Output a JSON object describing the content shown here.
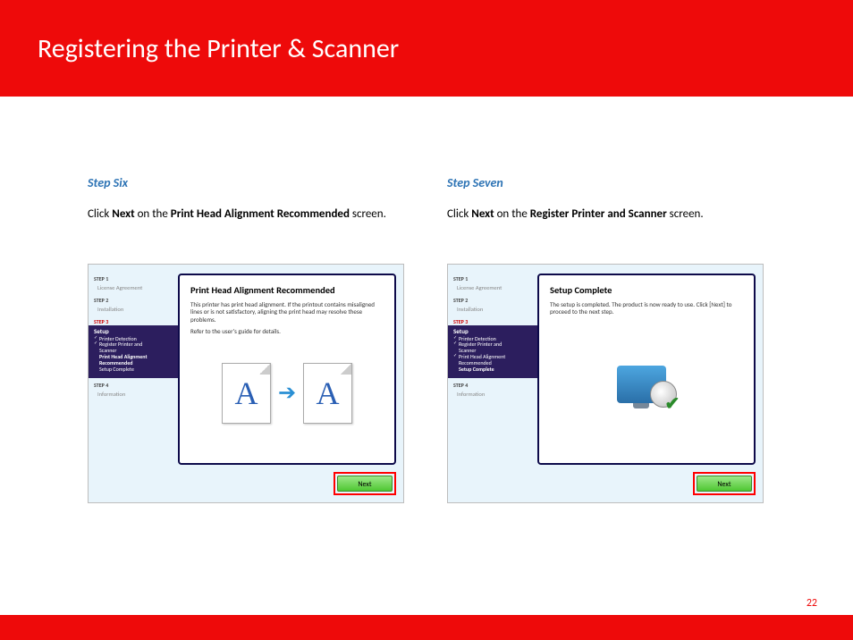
{
  "header": {
    "title": "Registering the Printer & Scanner"
  },
  "page_number": "22",
  "step6": {
    "label": "Step Six",
    "text_pre": "Click ",
    "text_bold1": "Next",
    "text_mid": " on the ",
    "text_bold2": "Print Head Alignment Recommended",
    "text_post": " screen.",
    "panel": {
      "title": "Print Head Alignment Recommended",
      "body1": "This printer has print head alignment. If the printout contains misaligned lines or is not satisfactory, aligning the print head may resolve these problems.",
      "body2": "Refer to the user's guide for details.",
      "letter": "A"
    },
    "next_label": "Next"
  },
  "step7": {
    "label": "Step Seven",
    "text_pre": "Click ",
    "text_bold1": "Next",
    "text_mid": " on the ",
    "text_bold2": "Register Printer and Scanner",
    "text_post": " screen.",
    "panel": {
      "title": "Setup Complete",
      "body1": "The setup is completed. The product is now ready to use. Click [Next] to proceed to the next step."
    },
    "next_label": "Next"
  },
  "sidebar": {
    "step1": "STEP 1",
    "step1_sub": "License Agreement",
    "step2": "STEP 2",
    "step2_sub": "Installation",
    "step3": "STEP 3",
    "setup_title": "Setup",
    "item1": "Printer Detection",
    "item2a": "Register Printer and",
    "item2b": "Scanner",
    "item3a": "Print Head Alignment",
    "item3b": "Recommended",
    "item4": "Setup Complete",
    "step4": "STEP 4",
    "step4_sub": "Information"
  }
}
